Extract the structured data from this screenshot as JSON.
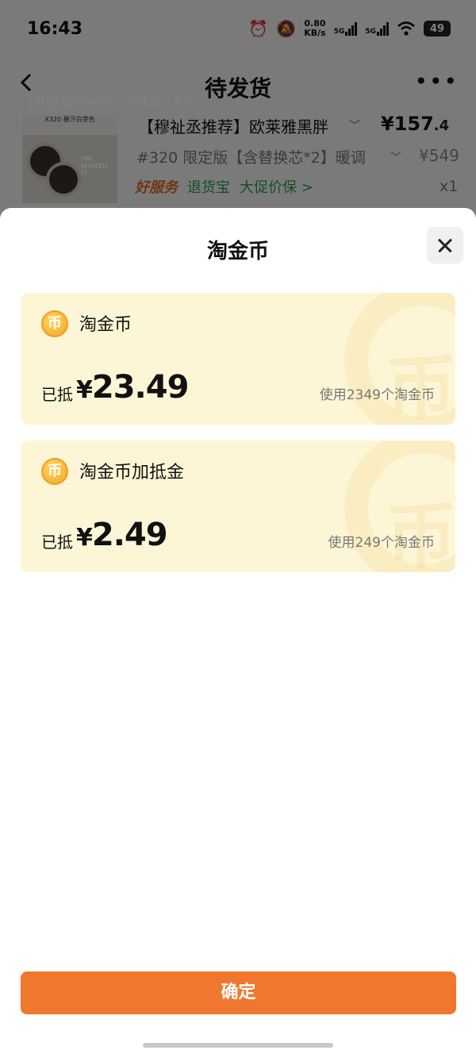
{
  "status_bar": {
    "time": "16:43",
    "net_speed_value": "0.80",
    "net_speed_unit": "KB/s",
    "signal_1": "5G",
    "signal_2": "5G",
    "battery": "49",
    "icons": [
      "alarm-icon",
      "mute-icon",
      "signal-icon",
      "wifi-icon",
      "battery-icon"
    ]
  },
  "nav": {
    "title": "待发货",
    "back_icon": "chevron-left-icon",
    "more_icon": "more-icon"
  },
  "watermark": "线报酷-new.xianbao.fun",
  "product": {
    "name": "【穆祉丞推荐】欧莱雅黑胖",
    "price_int": "¥157",
    "price_dec": ".4",
    "sku": "#320 限定版【含替换芯*2】暖调",
    "original_price": "¥549",
    "tags": [
      "好服务",
      "退货宝",
      "大促价保 >"
    ],
    "quantity": "x1",
    "thumb_label": "I'M WORTH IT",
    "thumb_text": "X320 暴汗白芽色"
  },
  "sheet": {
    "title": "淘金币",
    "close_icon": "close-icon",
    "cards": [
      {
        "label": "淘金币",
        "deduct_label": "已抵",
        "yen": "¥",
        "amount": "23.49",
        "note": "使用2349个淘金币"
      },
      {
        "label": "淘金币加抵金",
        "deduct_label": "已抵",
        "yen": "¥",
        "amount": "2.49",
        "note": "使用249个淘金币"
      }
    ],
    "coin_glyph": "币",
    "confirm_label": "确定"
  },
  "colors": {
    "accent": "#f0782e",
    "card_bg": "#fdf6d6",
    "coin": "#f4a41f",
    "tag_green": "#2f9b4a"
  }
}
